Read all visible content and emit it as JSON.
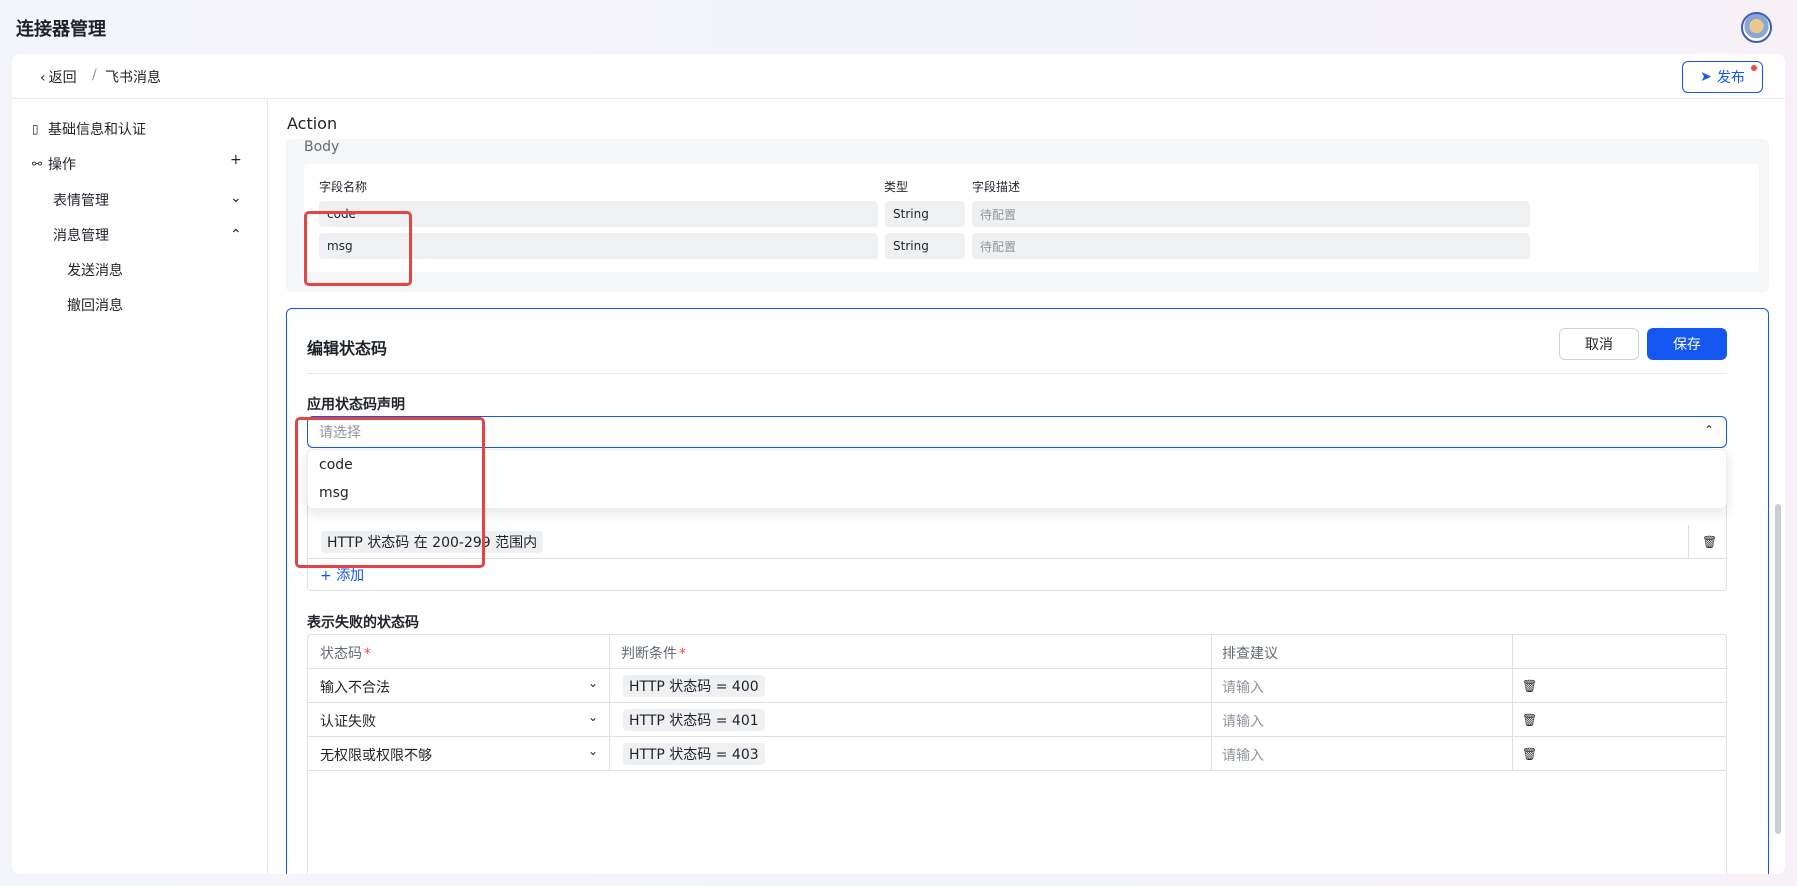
{
  "app": {
    "title": "连接器管理"
  },
  "breadcrumb": {
    "back_label": "返回",
    "separator": "/",
    "current": "飞书消息"
  },
  "toolbar": {
    "publish_label": "发布"
  },
  "sidebar": {
    "items": [
      {
        "label": "基础信息和认证",
        "icon": "document-icon"
      },
      {
        "label": "操作",
        "icon": "link-icon",
        "action": "+"
      },
      {
        "label": "表情管理",
        "chevron": "down"
      },
      {
        "label": "消息管理",
        "chevron": "up"
      },
      {
        "label": "发送消息"
      },
      {
        "label": "撤回消息"
      }
    ]
  },
  "main": {
    "section_title": "Action",
    "body": {
      "label": "Body",
      "headers": [
        "字段名称",
        "类型",
        "字段描述"
      ],
      "rows": [
        {
          "name": "code",
          "type": "String",
          "desc": "待配置"
        },
        {
          "name": "msg",
          "type": "String",
          "desc": "待配置"
        }
      ]
    },
    "edit": {
      "title": "编辑状态码",
      "cancel_label": "取消",
      "save_label": "保存",
      "field_label": "应用状态码声明",
      "select_placeholder": "请选择",
      "options": [
        "code",
        "msg"
      ],
      "success_condition": "HTTP 状态码 在 200-299 范围内",
      "add_label": "添加",
      "fail_label": "表示失败的状态码",
      "fail_headers": [
        "状态码",
        "判断条件",
        "排查建议"
      ],
      "fail_rows": [
        {
          "code": "输入不合法",
          "condition": "HTTP 状态码 = 400",
          "advice": "请输入"
        },
        {
          "code": "认证失败",
          "condition": "HTTP 状态码 = 401",
          "advice": "请输入"
        },
        {
          "code": "无权限或权限不够",
          "condition": "HTTP 状态码 = 403",
          "advice": "请输入"
        }
      ]
    }
  },
  "colors": {
    "accent": "#1456f0",
    "highlight": "#e34545",
    "required": "#f54a45"
  }
}
